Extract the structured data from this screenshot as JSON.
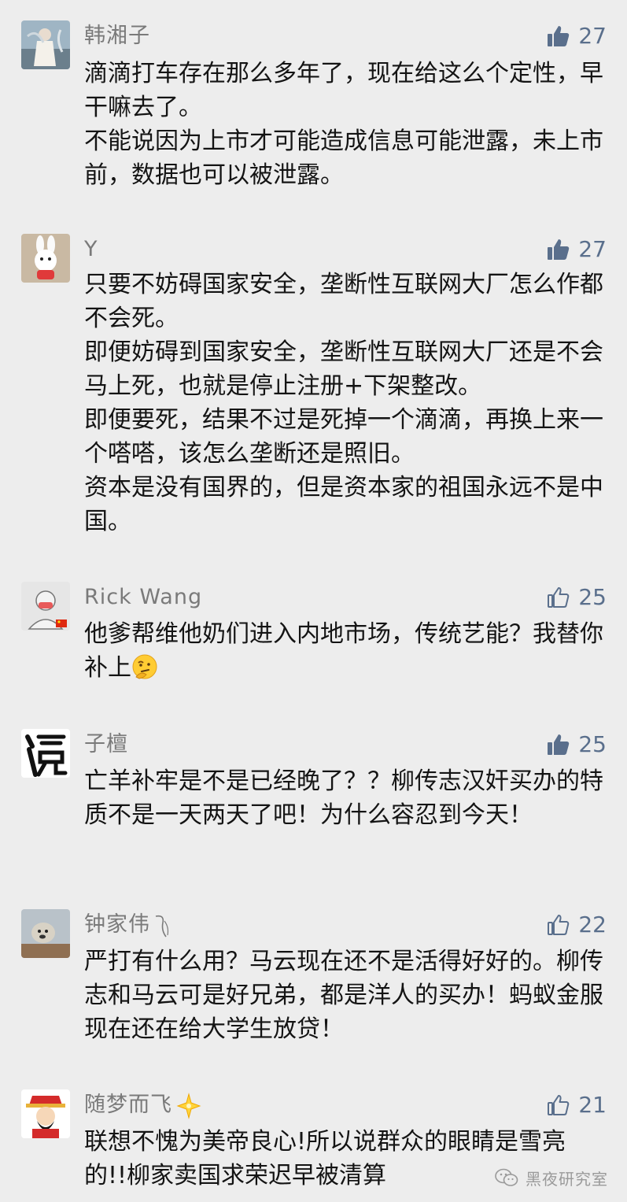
{
  "comments": [
    {
      "username": "韩湘子",
      "likes": "27",
      "liked": true,
      "lines": [
        "滴滴打车存在那么多年了，现在给这么个定性，早干嘛去了。",
        "不能说因为上市才可能造成信息可能泄露，未上市前，数据也可以被泄露。"
      ]
    },
    {
      "username": "Y",
      "likes": "27",
      "liked": true,
      "lines": [
        "只要不妨碍国家安全，垄断性互联网大厂怎么作都不会死。",
        "即便妨碍到国家安全，垄断性互联网大厂还是不会马上死，也就是停止注册+下架整改。",
        "即便要死，结果不过是死掉一个滴滴，再换上来一个嗒嗒，该怎么垄断还是照旧。",
        "资本是没有国界的，但是资本家的祖国永远不是中国。"
      ]
    },
    {
      "username": "Rick Wang",
      "likes": "25",
      "liked": false,
      "lines": [
        "他爹帮维他奶们进入内地市场，传统艺能？我替你补上"
      ],
      "emoji": "thinking-emoji"
    },
    {
      "username": "子檀",
      "likes": "25",
      "liked": true,
      "lines": [
        "亡羊补牢是不是已经晚了？？柳传志汉奸买办的特质不是一天两天了吧！为什么容忍到今天！"
      ]
    },
    {
      "username": "钟家伟",
      "likes": "22",
      "liked": false,
      "lines": [
        "严打有什么用？马云现在还不是活得好好的。柳传志和马云可是好兄弟，都是洋人的买办！蚂蚁金服现在还在给大学生放贷！"
      ]
    },
    {
      "username": "随梦而飞",
      "likes": "21",
      "liked": false,
      "lines": [
        "联想不愧为美帝良心!所以说群众的眼睛是雪亮的!!柳家卖国求荣迟早被清算"
      ]
    }
  ],
  "watermark": {
    "text": "黑夜研究室"
  },
  "colors": {
    "background": "#ededed",
    "username": "#7a7a7a",
    "like_accent": "#5a6f8c",
    "text": "#141414"
  }
}
